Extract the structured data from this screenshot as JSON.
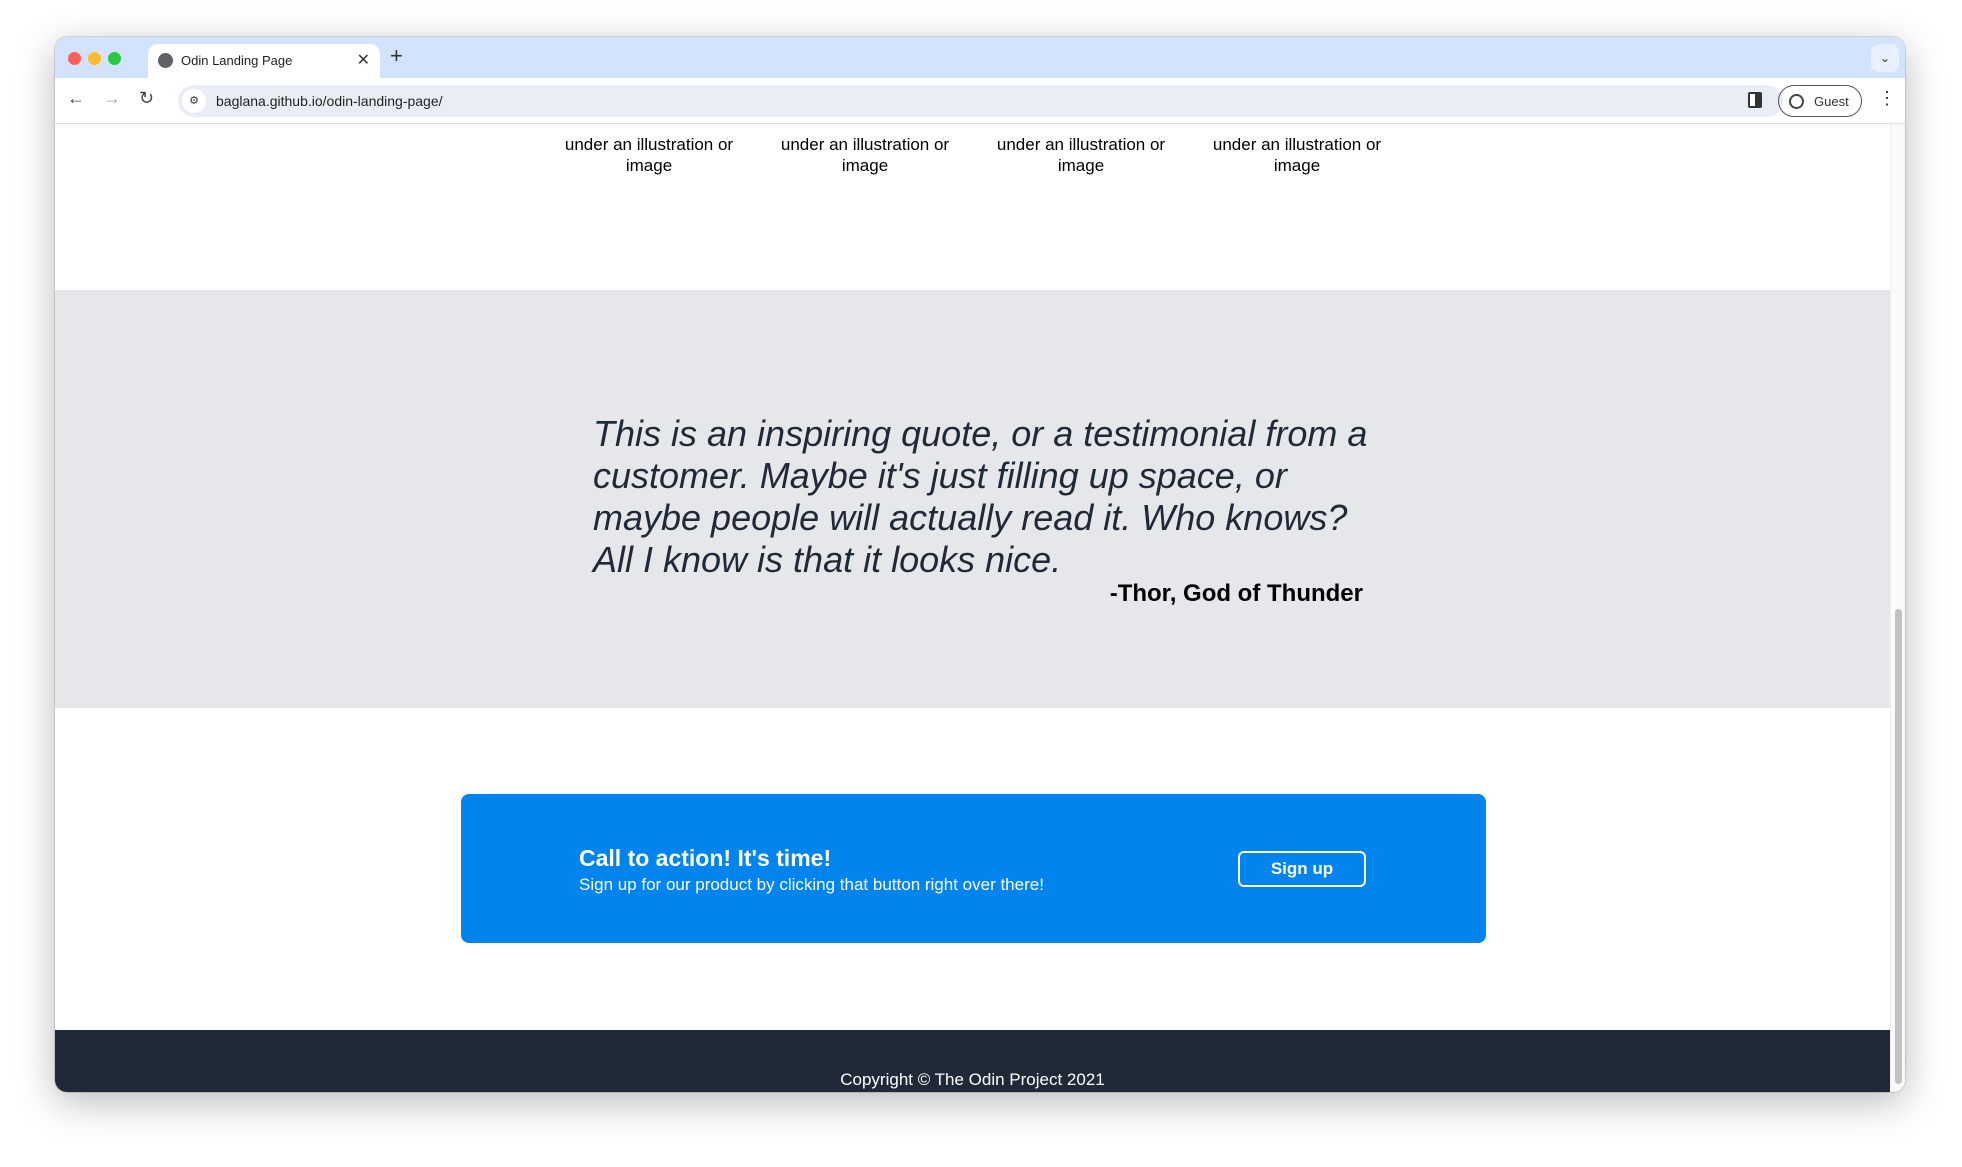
{
  "browser": {
    "tab_title": "Odin Landing Page",
    "url": "baglana.github.io/odin-landing-page/",
    "profile": "Guest"
  },
  "features": [
    {
      "caption": "under an illustration or image"
    },
    {
      "caption": "under an illustration or image"
    },
    {
      "caption": "under an illustration or image"
    },
    {
      "caption": "under an illustration or image"
    }
  ],
  "quote": {
    "text": "This is an inspiring quote, or a testimonial from a customer. Maybe it's just filling up space, or maybe people will actually read it. Who knows? All I know is that it looks nice.",
    "author": "-Thor, God of Thunder"
  },
  "cta": {
    "title": "Call to action! It's time!",
    "subtitle": "Sign up for our product by clicking that button right over there!",
    "button": "Sign up",
    "color": "#0284ee"
  },
  "footer": {
    "text": "Copyright © The Odin Project 2021",
    "color": "#1f2937"
  }
}
